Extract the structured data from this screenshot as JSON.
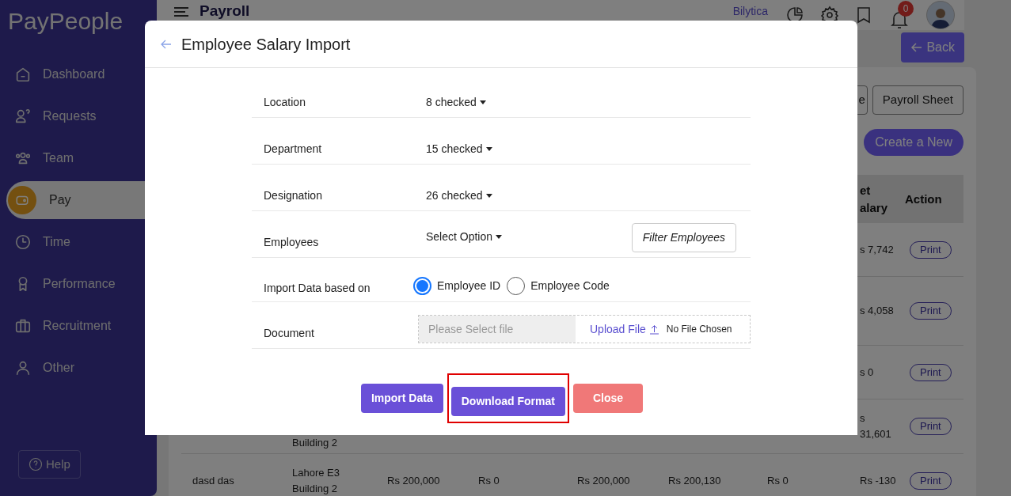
{
  "sidebar": {
    "logo": "PayPeople",
    "items": [
      {
        "label": "Dashboard",
        "selected": false
      },
      {
        "label": "Requests",
        "selected": false
      },
      {
        "label": "Team",
        "selected": false
      },
      {
        "label": "Pay",
        "selected": true
      },
      {
        "label": "Time",
        "selected": false
      },
      {
        "label": "Performance",
        "selected": false
      },
      {
        "label": "Recruitment",
        "selected": false
      },
      {
        "label": "Other",
        "selected": false
      }
    ],
    "help": "Help"
  },
  "header": {
    "title": "Payroll",
    "company": "Bilytica",
    "notification_count": "0"
  },
  "back_button": "Back",
  "toolbar_buttons": [
    "e",
    "Payroll Sheet"
  ],
  "create_button": "Create a New",
  "table": {
    "columns": {
      "column_8": "et alary",
      "column_9": "Action"
    },
    "rows": [
      {
        "cells": {
          "column_8": "s 7,742",
          "column_9": "Print"
        }
      },
      {
        "cells": {
          "column_8": "s 4,058",
          "column_9": "Print"
        }
      },
      {
        "cells": {
          "column_8": "s 0",
          "column_9": "Print"
        }
      },
      {
        "cells": {
          "column_2": "Building 2",
          "column_8": "s 31,601",
          "column_9": "Print"
        }
      },
      {
        "cells": {
          "column_1": "dasd das",
          "column_2": "Lahore E3 Building 2",
          "column_3": "Rs 200,000",
          "column_4": "Rs 0",
          "column_5": "Rs 200,000",
          "column_6": "Rs 200,130",
          "column_7": "Rs 0",
          "column_8": "Rs -130",
          "column_9": "Print"
        }
      }
    ]
  },
  "modal": {
    "title": "Employee Salary Import",
    "fields": [
      {
        "kind": "dropdown",
        "label": "Location",
        "value": "8 checked"
      },
      {
        "kind": "dropdown",
        "label": "Department",
        "value": "15 checked"
      },
      {
        "kind": "dropdown",
        "label": "Designation",
        "value": "26 checked"
      },
      {
        "kind": "dropdown",
        "label": "Employees",
        "value": "Select Option",
        "button": "Filter Employees"
      },
      {
        "kind": "radio",
        "label": "Import Data based on",
        "options": [
          {
            "label": "Employee ID",
            "selected": true
          },
          {
            "label": "Employee Code",
            "selected": false
          }
        ]
      },
      {
        "kind": "file",
        "label": "Document",
        "placeholder": "Please Select file",
        "upload": "Upload File",
        "status": "No File Chosen"
      }
    ],
    "buttons": [
      {
        "label": "Import Data",
        "kind": "primary",
        "highlighted": false
      },
      {
        "label": "Download Format",
        "kind": "primary",
        "highlighted": true
      },
      {
        "label": "Close",
        "kind": "danger",
        "highlighted": false
      }
    ]
  }
}
